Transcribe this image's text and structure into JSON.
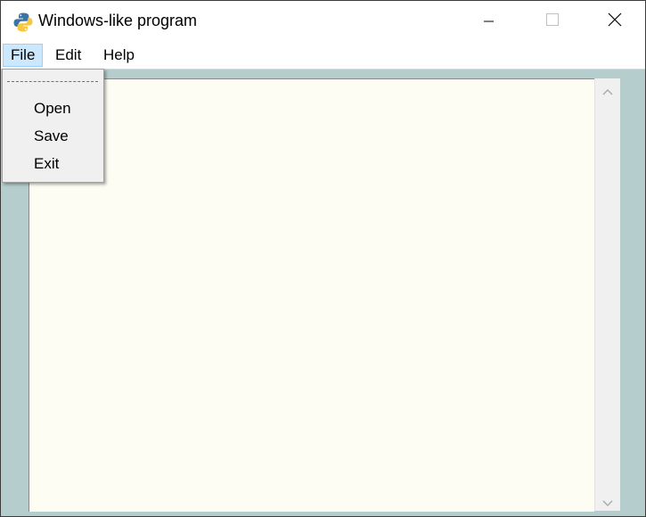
{
  "window": {
    "title": "Windows-like program",
    "controls": {
      "minimize": "minimize",
      "maximize": "maximize",
      "close": "close"
    }
  },
  "menubar": {
    "items": [
      {
        "label": "File",
        "active": true
      },
      {
        "label": "Edit",
        "active": false
      },
      {
        "label": "Help",
        "active": false
      }
    ]
  },
  "file_menu": {
    "tearoff": "- - - - - -",
    "items": [
      {
        "label": "Open"
      },
      {
        "label": "Save"
      },
      {
        "label": "Exit"
      }
    ]
  },
  "editor": {
    "content": ""
  },
  "colors": {
    "workspace_bg": "#b5cdcd",
    "editor_bg": "#fdfdf3",
    "menu_active_bg": "#cce8ff",
    "dropdown_bg": "#f0f0f0"
  },
  "icons": {
    "app": "python-icon",
    "scroll_up": "chevron-up-icon",
    "scroll_down": "chevron-down-icon"
  }
}
